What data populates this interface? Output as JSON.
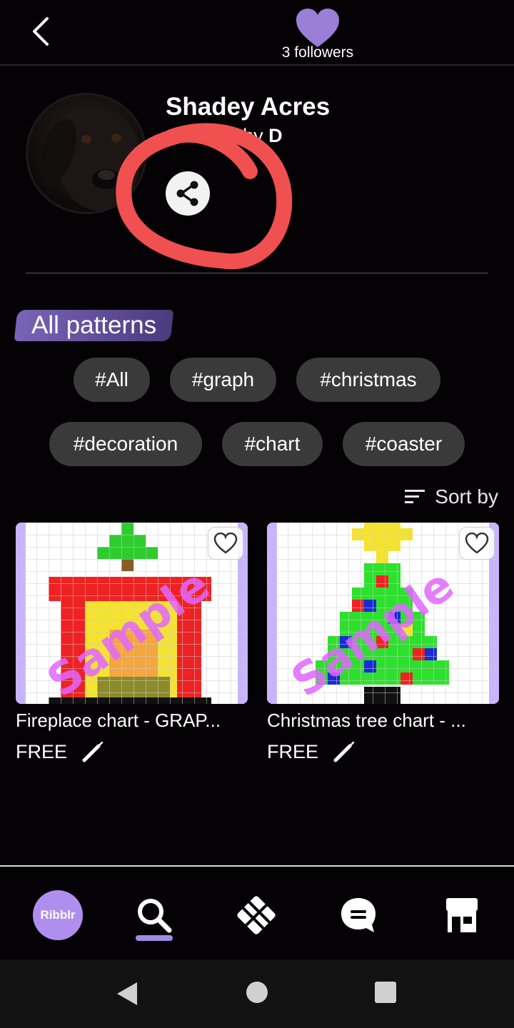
{
  "header": {
    "followers_text": "3 followers",
    "accent": "#9b7fd6"
  },
  "profile": {
    "name": "Shadey Acres",
    "subtitle_prefix": "s by",
    "author": "D"
  },
  "section": {
    "title": "All patterns"
  },
  "tags": [
    "#All",
    "#graph",
    "#christmas",
    "#decoration",
    "#chart",
    "#coaster"
  ],
  "sort": {
    "label": "Sort by"
  },
  "cards": [
    {
      "title": "Fireplace chart - GRAP...",
      "price": "FREE",
      "watermark": "Sample"
    },
    {
      "title": "Christmas tree chart - ...",
      "price": "FREE",
      "watermark": "Sample"
    }
  ],
  "nav": {
    "logo_text": "Ribblr",
    "items": [
      "home",
      "search",
      "patterns",
      "messages",
      "shop"
    ]
  },
  "colors": {
    "annotation": "#f05050",
    "tag_bg": "#3a3a3a",
    "card_grid_border": "#c9b3ff"
  }
}
